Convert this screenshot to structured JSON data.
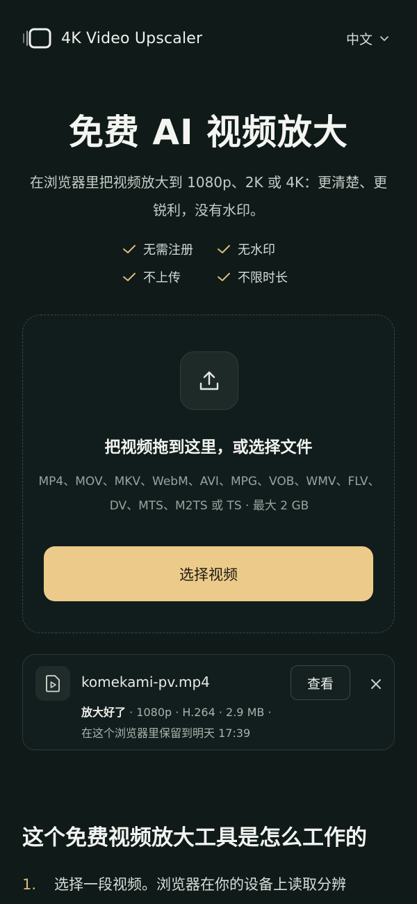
{
  "header": {
    "brand": "4K Video Upscaler",
    "language": "中文",
    "icons": {
      "logo": "video-frame-icon",
      "language": "chevron-down-icon"
    }
  },
  "hero": {
    "title": "免费 AI 视频放大",
    "subtitle": "在浏览器里把视频放大到 1080p、2K 或 4K：更清楚、更锐利，没有水印。",
    "checks": [
      "无需注册",
      "无水印",
      "不上传",
      "不限时长"
    ]
  },
  "dropzone": {
    "title": "把视频拖到这里，或选择文件",
    "formats": "MP4、MOV、MKV、WebM、AVI、MPG、VOB、WMV、FLV、DV、MTS、M2TS 或 TS · 最大 2 GB",
    "button": "选择视频",
    "icon": "upload-icon"
  },
  "file": {
    "name": "komekami-pv.mp4",
    "status": "放大好了",
    "details": " · 1080p · H.264 · 2.9 MB · ",
    "retention": "在这个浏览器里保留到明天 17:39",
    "view_button": "查看",
    "icons": {
      "file": "video-file-icon",
      "close": "close-icon"
    }
  },
  "how_it_works": {
    "title": "这个免费视频放大工具是怎么工作的",
    "steps": [
      {
        "number": "1.",
        "text": "选择一段视频。浏览器在你的设备上读取分辨"
      }
    ]
  },
  "colors": {
    "background": "#0f1a19",
    "accent": "#eccb8a",
    "check": "#e0bd79",
    "muted_text": "#9aa39e"
  }
}
